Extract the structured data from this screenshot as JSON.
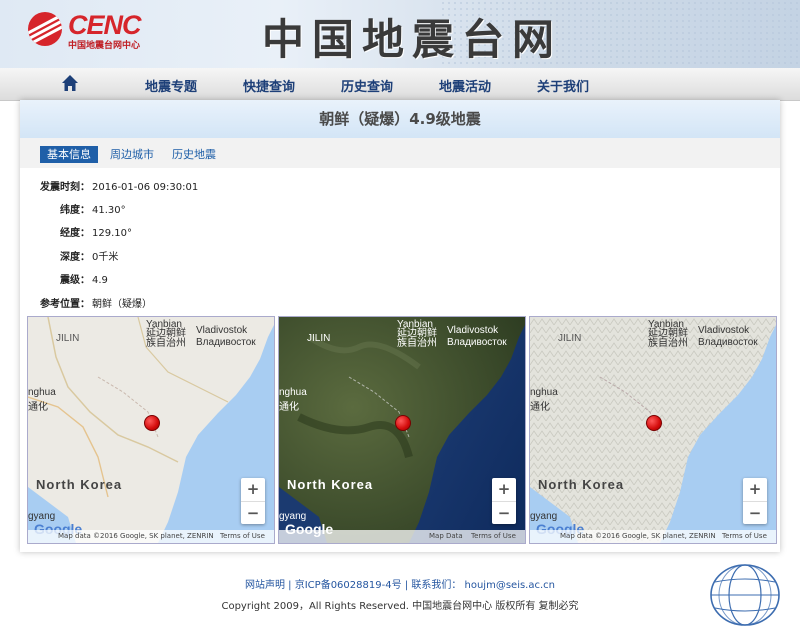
{
  "header": {
    "logo_text": "CENC",
    "logo_subtitle": "中国地震台网中心",
    "site_title": "中国地震台网"
  },
  "nav": {
    "home": "home-icon",
    "items": [
      "地震专题",
      "快捷查询",
      "历史查询",
      "地震活动",
      "关于我们"
    ]
  },
  "quake": {
    "title": "朝鲜（疑爆）4.9级地震",
    "tabs": [
      "基本信息",
      "周边城市",
      "历史地震"
    ],
    "active_tab": 0,
    "fields": [
      {
        "label": "发震时刻：",
        "value": "2016-01-06 09:30:01"
      },
      {
        "label": "纬度：",
        "value": "41.30°"
      },
      {
        "label": "经度：",
        "value": "129.10°"
      },
      {
        "label": "深度：",
        "value": "0千米"
      },
      {
        "label": "震级：",
        "value": "4.9"
      },
      {
        "label": "参考位置：",
        "value": "朝鲜（疑爆）"
      }
    ]
  },
  "maps": [
    {
      "type": "roadmap",
      "labels": {
        "jilin": "JILIN",
        "yanbian": "Yanbian",
        "yanbian_cn": "延边朝鲜\n族自治州",
        "vladivostok": "Vladivostok",
        "vladivostok_ru": "Владивосток",
        "country": "North Korea",
        "left_top": "nghua",
        "left_cn": "通化",
        "bottom_left": "gyang"
      },
      "attribution": "Map data ©2016 Google, SK planet, ZENRIN",
      "terms": "Terms of Use",
      "google": "Google",
      "zoom_in": "+",
      "zoom_out": "−"
    },
    {
      "type": "satellite",
      "labels": {
        "jilin": "JILIN",
        "yanbian": "Yanbian",
        "yanbian_cn": "延边朝鲜\n族自治州",
        "vladivostok": "Vladivostok",
        "vladivostok_ru": "Владивосток",
        "country": "North Korea",
        "left_top": "nghua",
        "left_cn": "通化",
        "bottom_left": "gyang"
      },
      "attribution": "Map Data",
      "terms": "Terms of Use",
      "google": "Google",
      "zoom_in": "+",
      "zoom_out": "−"
    },
    {
      "type": "terrain",
      "labels": {
        "jilin": "JILIN",
        "yanbian": "Yanbian",
        "yanbian_cn": "延边朝鲜\n族自治州",
        "vladivostok": "Vladivostok",
        "vladivostok_ru": "Владивосток",
        "country": "North Korea",
        "left_top": "nghua",
        "left_cn": "通化",
        "bottom_left": "gyang"
      },
      "attribution": "Map data ©2016 Google, SK planet, ZENRIN",
      "terms": "Terms of Use",
      "google": "Google",
      "zoom_in": "+",
      "zoom_out": "−"
    }
  ],
  "footer": {
    "link1": "网站声明",
    "link2": "京ICP备06028819-4号",
    "link3_label": "联系我们：",
    "link3_email": "houjm@seis.ac.cn",
    "copyright": "Copyright 2009，All Rights Reserved. 中国地震台网中心 版权所有 复制必究"
  }
}
